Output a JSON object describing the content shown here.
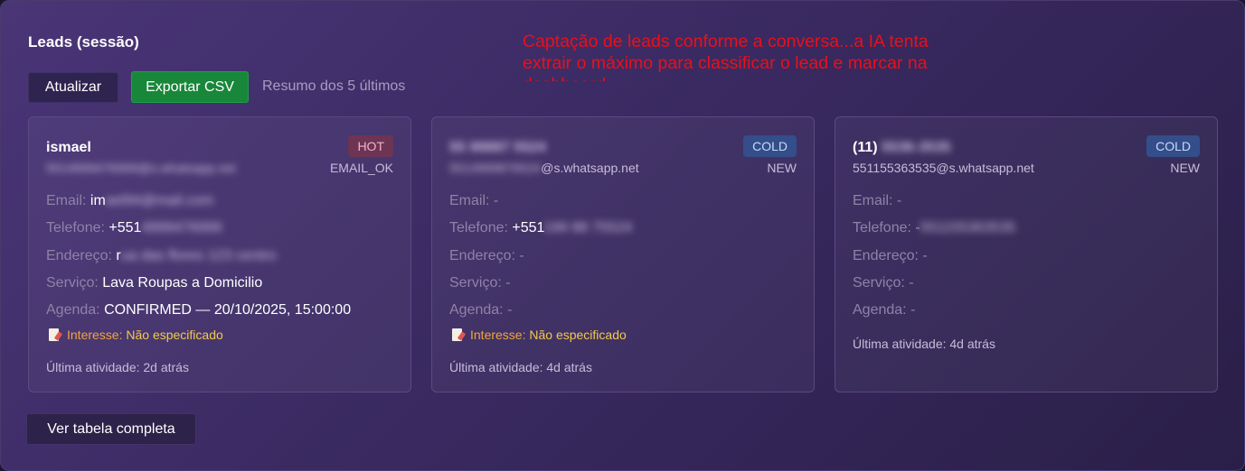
{
  "panel": {
    "title": "Leads (sessão)",
    "annotation": [
      "Captação de leads conforme a conversa...a IA tenta",
      "extrair o máximo para classificar o lead e marcar na",
      "dashboard"
    ],
    "buttons": {
      "refresh": "Atualizar",
      "export_csv": "Exportar CSV",
      "full_table": "Ver tabela completa"
    },
    "summary": "Resumo dos 5 últimos"
  },
  "labels": {
    "email": "Email:",
    "phone": "Telefone:",
    "address": "Endereço:",
    "service": "Serviço:",
    "schedule": "Agenda:",
    "interest": "Interesse:"
  },
  "cards": [
    {
      "name": "ismael",
      "name_hidden": "",
      "jid_visible": "",
      "jid_hidden": "5514999476999@s.whatsapp.net",
      "badge": "HOT",
      "status": "EMAIL_OK",
      "email_visible": "im",
      "email_hidden": "ael94@mail.com",
      "phone_visible": "+551",
      "phone_hidden": "4999476999",
      "address_visible": "r",
      "address_hidden": "ua das flores 123 centro",
      "service": "Lava Roupas a Domicilio",
      "schedule": "CONFIRMED — 20/10/2025, 15:00:00",
      "interest": "Não especificado",
      "activity": "Última atividade: 2d atrás"
    },
    {
      "name": "",
      "name_hidden": "55 99887 5524",
      "jid_visible": "@s.whatsapp.net",
      "jid_hidden": "5514999876524",
      "badge": "COLD",
      "status": "NEW",
      "email": "-",
      "phone_visible": "+551",
      "phone_hidden": "199 88 75524",
      "address": "-",
      "service": "-",
      "schedule": "-",
      "interest": "Não especificado",
      "activity": "Última atividade: 4d atrás"
    },
    {
      "name": "(11)",
      "name_hidden": "5536-3535",
      "jid": "551155363535@s.whatsapp.net",
      "badge": "COLD",
      "status": "NEW",
      "email": "-",
      "phone_visible": "-",
      "phone_hidden": "551155363535",
      "address": "-",
      "service": "-",
      "schedule": "-",
      "activity": "Última atividade: 4d atrás"
    }
  ]
}
